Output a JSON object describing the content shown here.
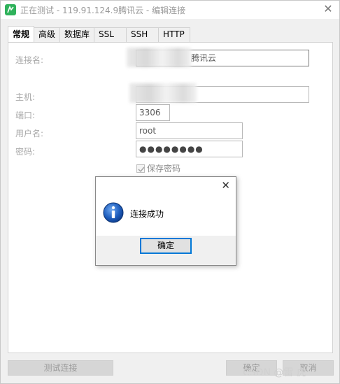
{
  "window": {
    "title": "正在测试 - 119.91.124.9腾讯云 - 编辑连接",
    "close_symbol": "✕"
  },
  "tabs": [
    {
      "label": "常规",
      "active": true
    },
    {
      "label": "高级",
      "active": false
    },
    {
      "label": "数据库",
      "active": false
    },
    {
      "label": "SSL",
      "active": false
    },
    {
      "label": "SSH",
      "active": false
    },
    {
      "label": "HTTP",
      "active": false
    }
  ],
  "form": {
    "connection_name_label": "连接名:",
    "connection_name_value": "腾讯云",
    "host_label": "主机:",
    "port_label": "端口:",
    "port_value": "3306",
    "username_label": "用户名:",
    "username_value": "root",
    "password_label": "密码:",
    "password_value": "●●●●●●●●",
    "save_password_label": "保存密码"
  },
  "footer": {
    "test_button": "测试连接",
    "ok_button": "确定",
    "cancel_button": "取消"
  },
  "dialog": {
    "close_symbol": "✕",
    "message": "连接成功",
    "ok_label": "确定",
    "icon": "info-icon"
  },
  "watermark": "CSDN @雷 虎",
  "colors": {
    "accent": "#0078d7",
    "info_blue": "#1f5fbf",
    "app_green": "#2fb25b"
  }
}
